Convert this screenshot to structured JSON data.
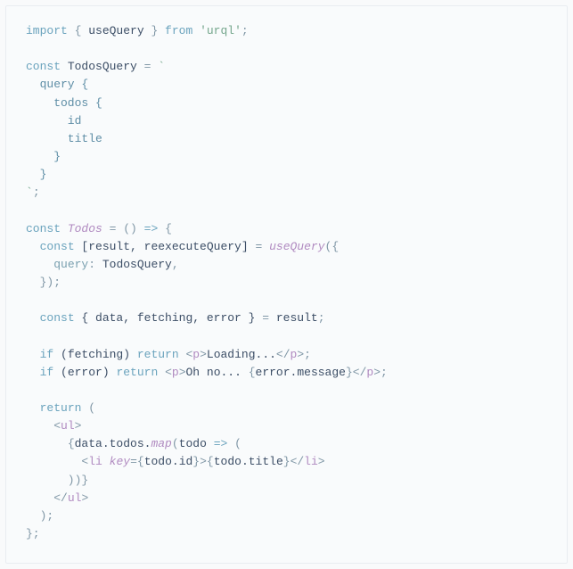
{
  "code": {
    "l1_import": "import",
    "l1_brace_o": " { ",
    "l1_usequery": "useQuery",
    "l1_brace_c": " } ",
    "l1_from": "from",
    "l1_sp": " ",
    "l1_str": "'urql'",
    "l1_semi": ";",
    "l3_const": "const",
    "l3_sp": " ",
    "l3_name": "TodosQuery",
    "l3_eq": " = ",
    "l3_tick": "`",
    "l4": "  query {",
    "l5": "    todos {",
    "l6": "      id",
    "l7": "      title",
    "l8": "    }",
    "l9": "  }",
    "l10_tick": "`",
    "l10_semi": ";",
    "l12_const": "const",
    "l12_name": " Todos ",
    "l12_eq": "=",
    "l12_par": " () ",
    "l12_arrow": "=>",
    "l12_brace": " {",
    "l13_pre": "  ",
    "l13_const": "const",
    "l13_arr": " [result, reexecuteQuery] ",
    "l13_eq": "=",
    "l13_sp": " ",
    "l13_fn": "useQuery",
    "l13_open": "({",
    "l14_pre": "    ",
    "l14_key": "query",
    "l14_colon": ": ",
    "l14_val": "TodosQuery",
    "l14_comma": ",",
    "l15": "  });",
    "l17_pre": "  ",
    "l17_const": "const",
    "l17_destr": " { data, fetching, error } ",
    "l17_eq": "=",
    "l17_res": " result",
    "l17_semi": ";",
    "l19_pre": "  ",
    "l19_if": "if",
    "l19_cond": " (fetching) ",
    "l19_ret": "return",
    "l19_sp": " ",
    "l19_tago": "<",
    "l19_tag": "p",
    "l19_tagc": ">",
    "l19_txt": "Loading...",
    "l19_ctago": "</",
    "l19_ctag": "p",
    "l19_ctagc": ">",
    "l19_semi": ";",
    "l20_pre": "  ",
    "l20_if": "if",
    "l20_cond": " (error) ",
    "l20_ret": "return",
    "l20_sp": " ",
    "l20_tago": "<",
    "l20_tag": "p",
    "l20_tagc": ">",
    "l20_txt": "Oh no... ",
    "l20_exo": "{",
    "l20_exp": "error.message",
    "l20_exc": "}",
    "l20_ctago": "</",
    "l20_ctag": "p",
    "l20_ctagc": ">",
    "l20_semi": ";",
    "l22_pre": "  ",
    "l22_ret": "return",
    "l22_p": " (",
    "l23_pre": "    ",
    "l23_tago": "<",
    "l23_tag": "ul",
    "l23_tagc": ">",
    "l24_pre": "      ",
    "l24_exo": "{",
    "l24_data": "data.todos.",
    "l24_map": "map",
    "l24_open": "(",
    "l24_arg": "todo ",
    "l24_arrow": "=>",
    "l24_p": " (",
    "l25_pre": "        ",
    "l25_tago": "<",
    "l25_tag": "li",
    "l25_sp": " ",
    "l25_key": "key",
    "l25_eq": "=",
    "l25_vo": "{",
    "l25_val": "todo.id",
    "l25_vc": "}",
    "l25_tagc": ">",
    "l25_exo": "{",
    "l25_exp": "todo.title",
    "l25_exc": "}",
    "l25_ctago": "</",
    "l25_ctag": "li",
    "l25_ctagc": ">",
    "l26": "      ))}",
    "l27_pre": "    ",
    "l27_ctago": "</",
    "l27_ctag": "ul",
    "l27_ctagc": ">",
    "l28": "  );",
    "l29": "};"
  }
}
